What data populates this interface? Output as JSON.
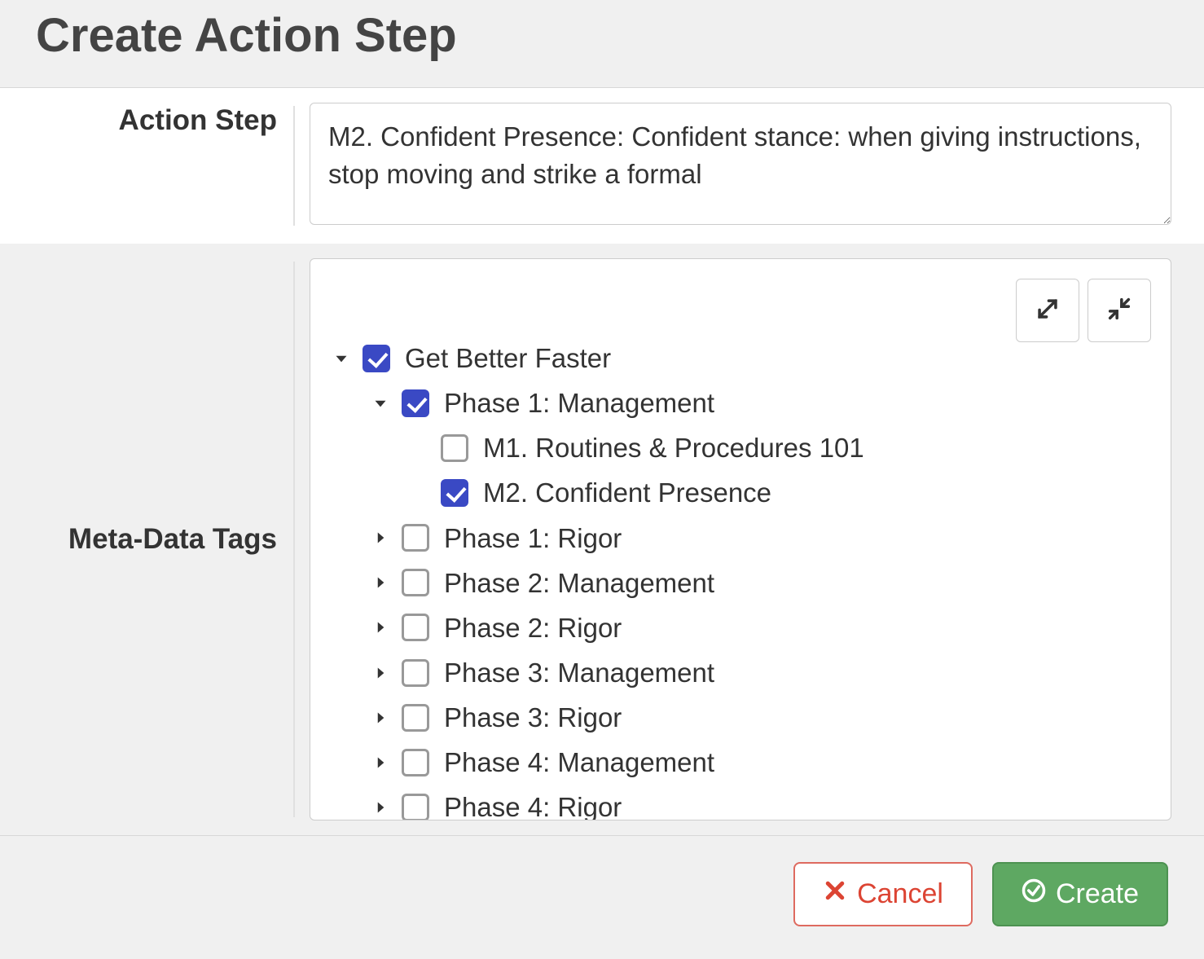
{
  "header": {
    "title": "Create Action Step"
  },
  "form": {
    "actionStep": {
      "label": "Action Step",
      "value": "M2. Confident Presence: Confident stance: when giving instructions, stop moving and strike a formal"
    },
    "metaDataTags": {
      "label": "Meta-Data Tags"
    }
  },
  "tree": {
    "label": "Get Better Faster",
    "checked": true,
    "expanded": true,
    "children": [
      {
        "label": "Phase 1: Management",
        "checked": true,
        "expanded": true,
        "children": [
          {
            "label": "M1. Routines & Procedures 101",
            "checked": false
          },
          {
            "label": "M2. Confident Presence",
            "checked": true
          }
        ]
      },
      {
        "label": "Phase 1: Rigor",
        "checked": false,
        "expanded": false,
        "children": []
      },
      {
        "label": "Phase 2: Management",
        "checked": false,
        "expanded": false,
        "children": []
      },
      {
        "label": "Phase 2: Rigor",
        "checked": false,
        "expanded": false,
        "children": []
      },
      {
        "label": "Phase 3: Management",
        "checked": false,
        "expanded": false,
        "children": []
      },
      {
        "label": "Phase 3: Rigor",
        "checked": false,
        "expanded": false,
        "children": []
      },
      {
        "label": "Phase 4: Management",
        "checked": false,
        "expanded": false,
        "children": []
      },
      {
        "label": "Phase 4: Rigor",
        "checked": false,
        "expanded": false,
        "children": []
      }
    ]
  },
  "footer": {
    "cancel": "Cancel",
    "create": "Create"
  },
  "icons": {
    "expand": "expand-icon",
    "collapse": "collapse-icon"
  }
}
